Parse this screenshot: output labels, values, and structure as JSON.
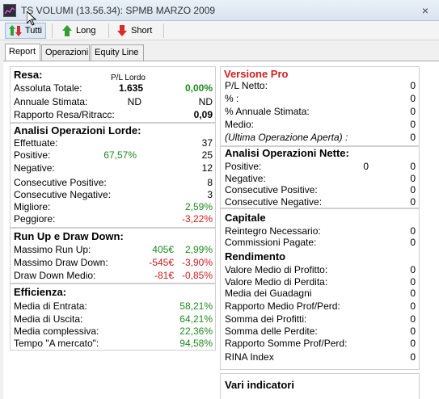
{
  "window": {
    "title": "TS VOLUMI (13.56.34): SPMB MARZO 2009",
    "close": "×"
  },
  "toolbar": {
    "all": "Tutti",
    "long": "Long",
    "short": "Short"
  },
  "tabs": [
    "Report",
    "Operazioni",
    "Equity Line"
  ],
  "resa": {
    "title": "Resa:",
    "col_header": "P/L Lordo",
    "assoluta_label": "Assoluta Totale:",
    "assoluta_val": "1.635",
    "assoluta_pct": "0,00%",
    "annuale_label": "Annuale Stimata:",
    "annuale_val": "ND",
    "annuale_pct": "ND",
    "rapporto_label": "Rapporto Resa/Ritracc:",
    "rapporto_val": "0,09"
  },
  "lorde": {
    "title": "Analisi Operazioni Lorde:",
    "effettuate_label": "Effettuate:",
    "effettuate_val": "37",
    "positive_label": "Positive:",
    "positive_pct": "67,57%",
    "positive_val": "25",
    "negative_label": "Negative:",
    "negative_val": "12",
    "cons_pos_label": "Consecutive Positive:",
    "cons_pos_val": "8",
    "cons_neg_label": "Consecutive Negative:",
    "cons_neg_val": "3",
    "migliore_label": "Migliore:",
    "migliore_val": "2,59%",
    "peggiore_label": "Peggiore:",
    "peggiore_val": "-3,22%"
  },
  "runup": {
    "title": "Run Up e Draw Down:",
    "max_runup_label": "Massimo Run Up:",
    "max_runup_eur": "405€",
    "max_runup_pct": "2,99%",
    "max_dd_label": "Massimo Draw Down:",
    "max_dd_eur": "-545€",
    "max_dd_pct": "-3,90%",
    "dd_medio_label": "Draw Down Medio:",
    "dd_medio_eur": "-81€",
    "dd_medio_pct": "-0,85%"
  },
  "efficienza": {
    "title": "Efficienza:",
    "entrata_label": "Media di Entrata:",
    "entrata_val": "58,21%",
    "uscita_label": "Media di Uscita:",
    "uscita_val": "64,21%",
    "complessiva_label": "Media complessiva:",
    "complessiva_val": "22,36%",
    "mercato_label": "Tempo \"A mercato\":",
    "mercato_val": "94,58%"
  },
  "pro": {
    "title": "Versione Pro",
    "pl_label": "P/L Netto:",
    "pl_val": "0",
    "pct_label": "% :",
    "pct_val": "0",
    "pct_ann_label": "% Annuale Stimata:",
    "pct_ann_val": "0",
    "medio_label": "Medio:",
    "medio_val": "0",
    "ultima_label": "(Ultima Operazione Aperta) :",
    "ultima_val": "0"
  },
  "nette": {
    "title": "Analisi Operazioni Nette:",
    "positive_label": "Positive:",
    "positive_a": "0",
    "positive_b": "0",
    "negative_label": "Negative:",
    "negative_val": "0",
    "cons_pos_label": "Consecutive Positive:",
    "cons_pos_val": "0",
    "cons_neg_label": "Consecutive Negative:",
    "cons_neg_val": "0"
  },
  "capitale": {
    "title": "Capitale",
    "reintegro_label": "Reintegro Necessario:",
    "reintegro_val": "0",
    "commissioni_label": "Commissioni Pagate:",
    "commissioni_val": "0"
  },
  "rendimento": {
    "title": "Rendimento",
    "vm_profitto_label": "Valore Medio di Profitto:",
    "vm_profitto_val": "0",
    "vm_perdita_label": "Valore Medio di Perdita:",
    "vm_perdita_val": "0",
    "media_guadagni_label": "Media dei Guadagni",
    "media_guadagni_val": "0",
    "rapporto_label": "Rapporto Medio Prof/Perd:",
    "rapporto_val": "0",
    "somma_profitti_label": "Somma dei Profitti:",
    "somma_profitti_val": "0",
    "somma_perdite_label": "Somma delle Perdite:",
    "somma_perdite_val": "0",
    "rapporto_somme_label": "Rapporto Somme Prof/Perd:",
    "rapporto_somme_val": "0",
    "rina_label": "RINA Index",
    "rina_val": "0"
  },
  "vari": {
    "title": "Vari indicatori"
  },
  "colors": {
    "green": "#1d8a1d",
    "red": "#d11a1a",
    "pro": "#d41c1c"
  }
}
